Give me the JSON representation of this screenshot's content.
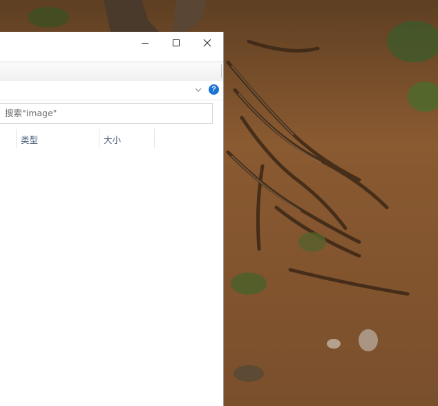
{
  "window": {
    "caption_buttons": [
      {
        "name": "minimize",
        "icon": "minimize-icon"
      },
      {
        "name": "maximize",
        "icon": "maximize-icon"
      },
      {
        "name": "close",
        "icon": "close-icon"
      }
    ]
  },
  "addressbar": {
    "expand_icon": "chevron-down-icon",
    "help_label": "?"
  },
  "search": {
    "text": "搜索\"image\""
  },
  "columns": {
    "type_label": "类型",
    "size_label": "大小"
  },
  "colors": {
    "help_blue": "#1a73d4",
    "column_header_text": "#4c607a",
    "search_text": "#6d6d6d"
  }
}
